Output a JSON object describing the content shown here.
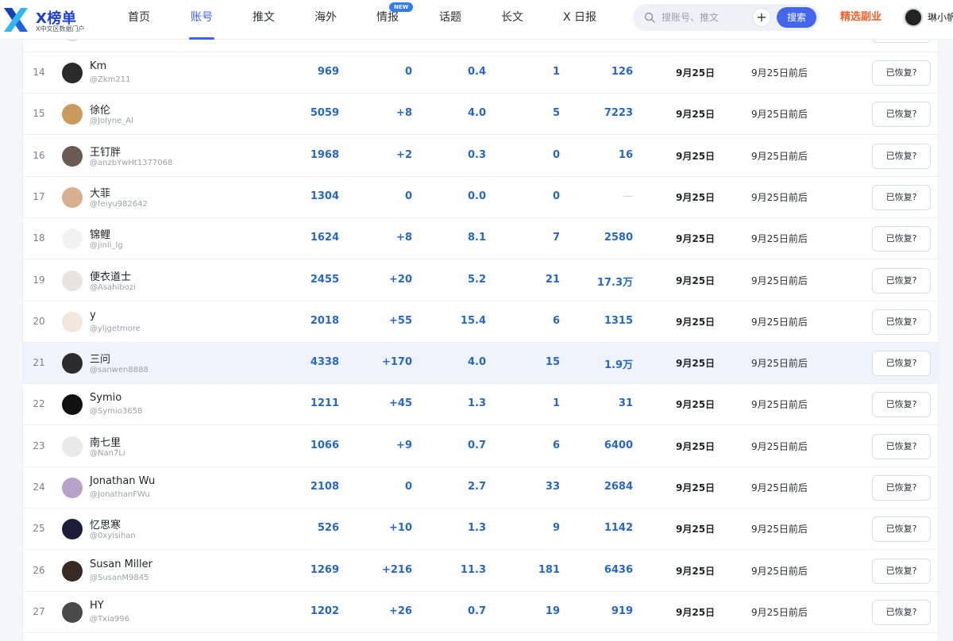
{
  "nav": {
    "brand_title": "X榜单",
    "brand_subtitle": "X中文区数据门户",
    "items": [
      {
        "label": "首页"
      },
      {
        "label": "账号"
      },
      {
        "label": "推文"
      },
      {
        "label": "海外"
      },
      {
        "label": "情报"
      },
      {
        "label": "话题"
      },
      {
        "label": "长文"
      },
      {
        "label": "X 日报"
      }
    ],
    "active_item": "账号",
    "new_badge": "NEW",
    "search": {
      "placeholder": "搜账号、推文",
      "plus": "+",
      "button": "搜索"
    },
    "side_link": "精选副业",
    "user_name": "琳小帆",
    "accent_color": "#3a63f3",
    "side_link_color": "#f0602a"
  },
  "table": {
    "restore_label": "已恢复?",
    "rows": [
      {
        "rank": "14",
        "name": "Km",
        "handle": "@Zkm211",
        "v1": "969",
        "v2": "0",
        "v3": "0.4",
        "v4": "1",
        "v5": "126",
        "d1": "9月25日",
        "d2": "9月25日前后",
        "avatar_color": "#2a2a2a"
      },
      {
        "rank": "15",
        "name": "徐伦",
        "handle": "@Jolyne_AI",
        "v1": "5059",
        "v2": "+8",
        "v3": "4.0",
        "v4": "5",
        "v5": "7223",
        "d1": "9月25日",
        "d2": "9月25日前后",
        "avatar_color": "#c99a5b"
      },
      {
        "rank": "16",
        "name": "王钉胖",
        "handle": "@anzbYwHt1377068",
        "v1": "1968",
        "v2": "+2",
        "v3": "0.3",
        "v4": "0",
        "v5": "16",
        "d1": "9月25日",
        "d2": "9月25日前后",
        "avatar_color": "#6a5a52"
      },
      {
        "rank": "17",
        "name": "大菲",
        "handle": "@feiyu982642",
        "v1": "1304",
        "v2": "0",
        "v3": "0.0",
        "v4": "0",
        "v5": "—",
        "d1": "9月25日",
        "d2": "9月25日前后",
        "avatar_color": "#d9b08f"
      },
      {
        "rank": "18",
        "name": "锦鲤",
        "handle": "@jinli_lg",
        "v1": "1624",
        "v2": "+8",
        "v3": "8.1",
        "v4": "7",
        "v5": "2580",
        "d1": "9月25日",
        "d2": "9月25日前后",
        "avatar_color": "#f2f2f2"
      },
      {
        "rank": "19",
        "name": "便衣道士",
        "handle": "@Asahibozi",
        "v1": "2455",
        "v2": "+20",
        "v3": "5.2",
        "v4": "21",
        "v5": "17.3万",
        "d1": "9月25日",
        "d2": "9月25日前后",
        "avatar_color": "#e8e4df"
      },
      {
        "rank": "20",
        "name": "y",
        "handle": "@yljgetmore",
        "v1": "2018",
        "v2": "+55",
        "v3": "15.4",
        "v4": "6",
        "v5": "1315",
        "d1": "9月25日",
        "d2": "9月25日前后",
        "avatar_color": "#f3e6da"
      },
      {
        "rank": "21",
        "name": "三问",
        "handle": "@sanwen8888",
        "v1": "4338",
        "v2": "+170",
        "v3": "4.0",
        "v4": "15",
        "v5": "1.9万",
        "d1": "9月25日",
        "d2": "9月25日前后",
        "avatar_color": "#2b2b2b",
        "highlight": true
      },
      {
        "rank": "22",
        "name": "Symio",
        "handle": "@Symio3658",
        "v1": "1211",
        "v2": "+45",
        "v3": "1.3",
        "v4": "1",
        "v5": "31",
        "d1": "9月25日",
        "d2": "9月25日前后",
        "avatar_color": "#111111"
      },
      {
        "rank": "23",
        "name": "南七里",
        "handle": "@Nan7Li",
        "v1": "1066",
        "v2": "+9",
        "v3": "0.7",
        "v4": "6",
        "v5": "6400",
        "d1": "9月25日",
        "d2": "9月25日前后",
        "avatar_color": "#e9e9e9"
      },
      {
        "rank": "24",
        "name": "Jonathan Wu",
        "handle": "@JonathanFWu",
        "v1": "2108",
        "v2": "0",
        "v3": "2.7",
        "v4": "33",
        "v5": "2684",
        "d1": "9月25日",
        "d2": "9月25日前后",
        "avatar_color": "#b7a3c9"
      },
      {
        "rank": "25",
        "name": "忆思寒",
        "handle": "@0xyisihan",
        "v1": "526",
        "v2": "+10",
        "v3": "1.3",
        "v4": "9",
        "v5": "1142",
        "d1": "9月25日",
        "d2": "9月25日前后",
        "avatar_color": "#1d1d3a"
      },
      {
        "rank": "26",
        "name": "Susan Miller",
        "handle": "@SusanM9845",
        "v1": "1269",
        "v2": "+216",
        "v3": "11.3",
        "v4": "181",
        "v5": "6436",
        "d1": "9月25日",
        "d2": "9月25日前后",
        "avatar_color": "#3a2a24"
      },
      {
        "rank": "27",
        "name": "HY",
        "handle": "@Txia996",
        "v1": "1202",
        "v2": "+26",
        "v3": "0.7",
        "v4": "19",
        "v5": "919",
        "d1": "9月25日",
        "d2": "9月25日前后",
        "avatar_color": "#4a4a4a"
      }
    ]
  }
}
